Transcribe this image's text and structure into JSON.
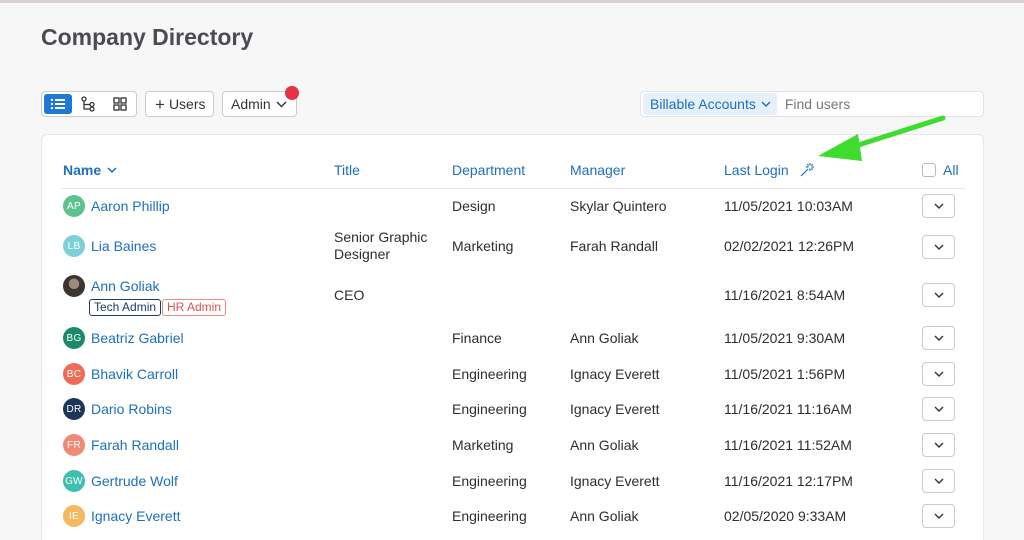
{
  "page": {
    "title": "Company Directory"
  },
  "toolbar": {
    "view_icons": [
      "list-view-icon",
      "org-chart-icon",
      "grid-view-icon"
    ],
    "add_users_label": "Users",
    "admin_label": "Admin",
    "filter_label": "Billable Accounts",
    "search_placeholder": "Find users"
  },
  "table": {
    "headers": {
      "name": "Name",
      "title": "Title",
      "department": "Department",
      "manager": "Manager",
      "last_login": "Last Login",
      "all": "All"
    },
    "rows": [
      {
        "initials": "AP",
        "avatar_color": "#5ec28f",
        "name": "Aaron Phillip",
        "title": "",
        "title_line2": "",
        "department": "Design",
        "manager": "Skylar Quintero",
        "last_login": "11/05/2021 10:03AM"
      },
      {
        "initials": "LB",
        "avatar_color": "#7ed0d8",
        "name": "Lia Baines",
        "title": "Senior Graphic",
        "title_line2": "Designer",
        "department": "Marketing",
        "manager": "Farah Randall",
        "last_login": "02/02/2021 12:26PM"
      },
      {
        "initials": "",
        "avatar_color": "#4a423f",
        "name": "Ann Goliak",
        "title": "CEO",
        "title_line2": "",
        "department": "",
        "manager": "",
        "last_login": "11/16/2021 8:54AM",
        "badges": [
          "Tech Admin",
          "HR Admin"
        ]
      },
      {
        "initials": "BG",
        "avatar_color": "#1a8a6a",
        "name": "Beatriz Gabriel",
        "title": "",
        "title_line2": "",
        "department": "Finance",
        "manager": "Ann Goliak",
        "last_login": "11/05/2021 9:30AM"
      },
      {
        "initials": "BC",
        "avatar_color": "#ef6b57",
        "name": "Bhavik Carroll",
        "title": "",
        "title_line2": "",
        "department": "Engineering",
        "manager": "Ignacy Everett",
        "last_login": "11/05/2021 1:56PM"
      },
      {
        "initials": "DR",
        "avatar_color": "#1c3659",
        "name": "Dario Robins",
        "title": "",
        "title_line2": "",
        "department": "Engineering",
        "manager": "Ignacy Everett",
        "last_login": "11/16/2021 11:16AM"
      },
      {
        "initials": "FR",
        "avatar_color": "#f08a75",
        "name": "Farah Randall",
        "title": "",
        "title_line2": "",
        "department": "Marketing",
        "manager": "Ann Goliak",
        "last_login": "11/16/2021 11:52AM"
      },
      {
        "initials": "GW",
        "avatar_color": "#3fbfb1",
        "name": "Gertrude Wolf",
        "title": "",
        "title_line2": "",
        "department": "Engineering",
        "manager": "Ignacy Everett",
        "last_login": "11/16/2021 12:17PM"
      },
      {
        "initials": "IE",
        "avatar_color": "#f4b860",
        "name": "Ignacy Everett",
        "title": "",
        "title_line2": "",
        "department": "Engineering",
        "manager": "Ann Goliak",
        "last_login": "02/05/2020 9:33AM"
      }
    ]
  },
  "colors": {
    "accent": "#1e78d6",
    "link": "#1d6fbf",
    "notification": "#e53240",
    "annotation_arrow": "#3ddc2f"
  }
}
